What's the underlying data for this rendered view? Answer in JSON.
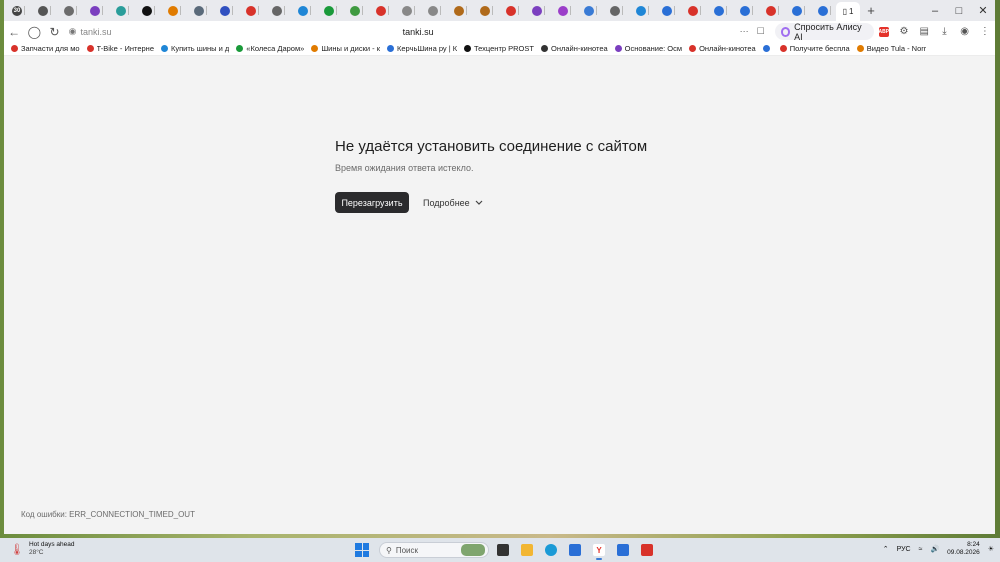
{
  "browser": {
    "tabs": [
      {
        "label": "30",
        "color": "#444444"
      },
      {
        "label": "",
        "color": "#555555"
      },
      {
        "label": "",
        "color": "#6c6c6c"
      },
      {
        "label": "",
        "color": "#7b3fbf"
      },
      {
        "label": "",
        "color": "#2a9d9a"
      },
      {
        "label": "",
        "color": "#111111"
      },
      {
        "label": "",
        "color": "#e07b00"
      },
      {
        "label": "",
        "color": "#5a6a7a"
      },
      {
        "label": "",
        "color": "#3050c0"
      },
      {
        "label": "",
        "color": "#d8322a"
      },
      {
        "label": "",
        "color": "#666666"
      },
      {
        "label": "",
        "color": "#1f86d6"
      },
      {
        "label": "",
        "color": "#1a9a3a"
      },
      {
        "label": "",
        "color": "#3f9a40"
      },
      {
        "label": "",
        "color": "#d8322a"
      },
      {
        "label": "",
        "color": "#888888"
      },
      {
        "label": "",
        "color": "#888888"
      },
      {
        "label": "",
        "color": "#b06a1a"
      },
      {
        "label": "",
        "color": "#b06a1a"
      },
      {
        "label": "",
        "color": "#d8322a"
      },
      {
        "label": "",
        "color": "#7b3fbf"
      },
      {
        "label": "",
        "color": "#9b3ec9"
      },
      {
        "label": "",
        "color": "#3a7bd5"
      },
      {
        "label": "",
        "color": "#666666"
      },
      {
        "label": "",
        "color": "#1f86d6"
      },
      {
        "label": "",
        "color": "#2a6fd6"
      },
      {
        "label": "",
        "color": "#d8322a"
      },
      {
        "label": "",
        "color": "#2a6fd6"
      },
      {
        "label": "",
        "color": "#2a6fd6"
      },
      {
        "label": "",
        "color": "#d8322a"
      },
      {
        "label": "",
        "color": "#2a6fd6"
      },
      {
        "label": "",
        "color": "#2a6fd6"
      }
    ],
    "active_tab_label": "1",
    "address": {
      "host": "tanki.su",
      "display": "tanki.su"
    },
    "alice_button": "Спросить Алису AI",
    "bookmarks": [
      {
        "label": "Запчасти для мо",
        "color": "#d8322a"
      },
      {
        "label": "T-Bike - Интерне",
        "color": "#d8322a"
      },
      {
        "label": "Купить шины и д",
        "color": "#1f86d6"
      },
      {
        "label": "«Колеса Даром»",
        "color": "#1a9a3a"
      },
      {
        "label": "Шины и диски - к",
        "color": "#e07b00"
      },
      {
        "label": "КерчьШина ру | К",
        "color": "#2a6fd6"
      },
      {
        "label": "Техцентр PROSTI",
        "color": "#111111"
      },
      {
        "label": "Онлайн-кинотеа",
        "color": "#333333"
      },
      {
        "label": "Основание: Осм",
        "color": "#7b3fbf"
      },
      {
        "label": "Онлайн-кинотеа",
        "color": "#d8322a"
      },
      {
        "label": "",
        "color": "#2a6fd6"
      },
      {
        "label": "Получите беспла",
        "color": "#d8322a"
      },
      {
        "label": "Видео Tula - Norr",
        "color": "#e07b00"
      }
    ]
  },
  "page": {
    "title": "Не удаётся установить соединение с сайтом",
    "subtitle": "Время ожидания ответа истекло.",
    "reload_button": "Перезагрузить",
    "details_button": "Подробнее",
    "error_code_label": "Код ошибки:",
    "error_code": "ERR_CONNECTION_TIMED_OUT"
  },
  "taskbar": {
    "weather_title": "Hot days ahead",
    "weather_temp": "28°C",
    "search_placeholder": "Поиск",
    "language": "РУС",
    "time": "8:24",
    "date": "09.08.2026"
  }
}
